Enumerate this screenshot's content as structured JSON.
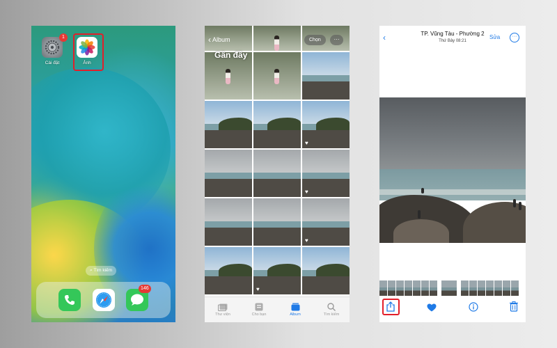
{
  "home": {
    "apps": [
      {
        "label": "Cài đặt",
        "badge": "1",
        "icon": "settings-gear-icon"
      },
      {
        "label": "Ảnh",
        "icon": "photos-flower-icon"
      }
    ],
    "search_label": "Tìm kiếm",
    "dock": [
      {
        "icon": "phone-icon"
      },
      {
        "icon": "safari-compass-icon"
      },
      {
        "icon": "messages-icon",
        "badge": "146"
      }
    ]
  },
  "album": {
    "back_label": "Album",
    "select_label": "Chọn",
    "more_label": "···",
    "title": "Gần đây",
    "tabs": [
      {
        "label": "Thư viện",
        "icon": "library-icon"
      },
      {
        "label": "Cho bạn",
        "icon": "for-you-icon"
      },
      {
        "label": "Album",
        "icon": "album-icon",
        "active": true
      },
      {
        "label": "Tìm kiếm",
        "icon": "search-icon"
      }
    ]
  },
  "viewer": {
    "title": "TP. Vũng Tàu - Phường 2",
    "subtitle": "Thứ Bảy  08:21",
    "edit_label": "Sửa",
    "toolbar": [
      "share-icon",
      "heart-icon",
      "info-icon",
      "trash-icon"
    ]
  },
  "colors": {
    "accent": "#1f7ae6",
    "highlight": "#e21f2a",
    "badge": "#e53935"
  }
}
